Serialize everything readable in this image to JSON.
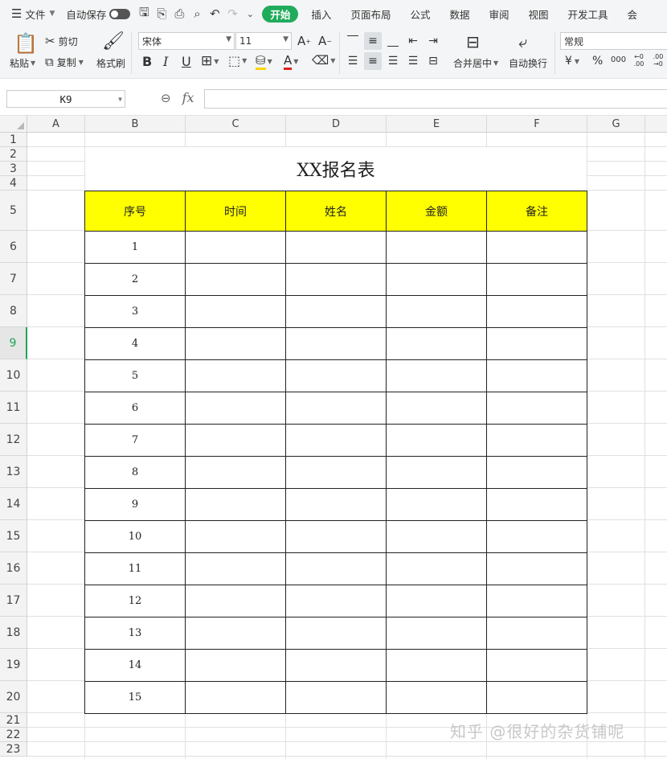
{
  "menubar": {
    "file_label": "文件",
    "autosave_label": "自动保存",
    "tabs": [
      "开始",
      "插入",
      "页面布局",
      "公式",
      "数据",
      "审阅",
      "视图",
      "开发工具",
      "会"
    ]
  },
  "ribbon": {
    "paste_label": "粘贴",
    "cut_label": "剪切",
    "copy_label": "复制",
    "format_painter_label": "格式刷",
    "font_name": "宋体",
    "font_size": "11",
    "merge_center_label": "合并居中",
    "wrap_text_label": "自动换行",
    "number_format": "常规",
    "currency_symbol": "¥",
    "percent_symbol": "%",
    "thousands_symbol": "000",
    "inc_decimal": "←0 .00",
    "dec_decimal": ".00 →0"
  },
  "formula_bar": {
    "name_box": "K9",
    "fx_label": "fx",
    "formula": ""
  },
  "sheet": {
    "columns": [
      "A",
      "B",
      "C",
      "D",
      "E",
      "F",
      "G"
    ],
    "rows": [
      "1",
      "2",
      "3",
      "4",
      "5",
      "6",
      "7",
      "8",
      "9",
      "10",
      "11",
      "12",
      "13",
      "14",
      "15",
      "16",
      "17",
      "18",
      "19",
      "20",
      "21",
      "22",
      "23"
    ],
    "selected_row": "9",
    "title": "XX报名表",
    "headers": [
      "序号",
      "时间",
      "姓名",
      "金额",
      "备注"
    ],
    "serials": [
      "1",
      "2",
      "3",
      "4",
      "5",
      "6",
      "7",
      "8",
      "9",
      "10",
      "11",
      "12",
      "13",
      "14",
      "15"
    ]
  },
  "watermark": "知乎 @很好的杂货铺呢",
  "colors": {
    "accent": "#1fab5b",
    "header_fill": "#ffff00"
  }
}
